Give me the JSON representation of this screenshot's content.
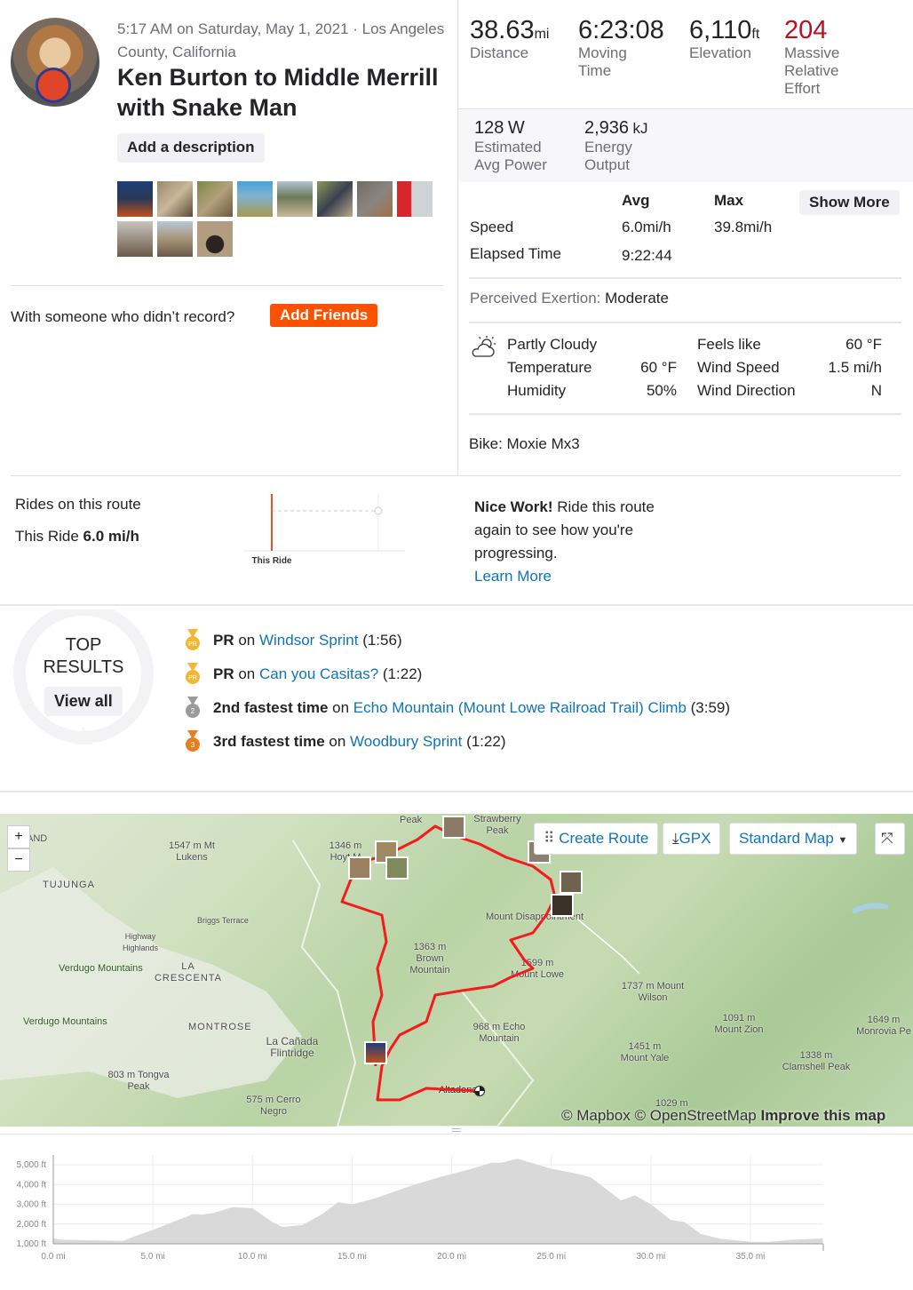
{
  "activity": {
    "meta": "5:17 AM on Saturday, May 1, 2021 · Los Angeles County, California",
    "title": "Ken Burton to Middle Merrill with Snake Man",
    "add_description": "Add a description",
    "photo_count": 11,
    "friends_prompt": "With someone who didn’t record?",
    "add_friends": "Add Friends"
  },
  "stats": {
    "distance": {
      "value": "38.63",
      "unit": "mi",
      "label": "Distance"
    },
    "moving_time": {
      "value": "6:23:08",
      "label": "Moving Time"
    },
    "elevation": {
      "value": "6,110",
      "unit": "ft",
      "label": "Elevation"
    },
    "relative_effort": {
      "value": "204",
      "label": "Massive Relative Effort",
      "color": "#b8101f"
    },
    "power": {
      "value": "128",
      "unit": "W",
      "label": "Estimated Avg Power"
    },
    "energy": {
      "value": "2,936",
      "unit": "kJ",
      "label": "Energy Output"
    },
    "table": {
      "avg_header": "Avg",
      "max_header": "Max",
      "show_more": "Show More",
      "speed_label": "Speed",
      "speed_avg": "6.0mi/h",
      "speed_max": "39.8mi/h",
      "elapsed_label": "Elapsed Time",
      "elapsed_avg": "9:22:44"
    },
    "perceived_label": "Perceived Exertion:",
    "perceived_value": "Moderate",
    "weather": {
      "icon": "partly-cloudy-icon",
      "condition": "Partly Cloudy",
      "temp_label": "Temperature",
      "temp": "60 °F",
      "humidity_label": "Humidity",
      "humidity": "50%",
      "feels_label": "Feels like",
      "feels": "60 °F",
      "wind_speed_label": "Wind Speed",
      "wind_speed": "1.5 mi/h",
      "wind_dir_label": "Wind Direction",
      "wind_dir": "N"
    },
    "bike": "Bike: Moxie Mx3"
  },
  "route": {
    "title": "Rides on this route",
    "this_ride_label": "This Ride",
    "this_ride_value": "6.0 mi/h",
    "chart_label": "This Ride",
    "nice_work": "Nice Work!",
    "nice_text": " Ride this route again to see how you're progressing.",
    "learn_more": "Learn More"
  },
  "top_results": {
    "title_1": "TOP",
    "title_2": "RESULTS",
    "view_all": "View all",
    "items": [
      {
        "medal": "PR",
        "color": "#f5b731",
        "bold": "PR",
        "on": " on ",
        "segment": "Windsor Sprint",
        "time": " (1:56)"
      },
      {
        "medal": "PR",
        "color": "#f5b731",
        "bold": "PR",
        "on": " on ",
        "segment": "Can you Casitas?",
        "time": " (1:22)"
      },
      {
        "medal": "2",
        "color": "#9b9b9b",
        "bold": "2nd fastest time",
        "on": " on ",
        "segment": "Echo Mountain (Mount Lowe Railroad Trail) Climb",
        "time": " (3:59)"
      },
      {
        "medal": "3",
        "color": "#e67e22",
        "bold": "3rd fastest time",
        "on": " on ",
        "segment": "Woodbury Sprint",
        "time": " (1:22)"
      }
    ]
  },
  "map": {
    "create_route": "Create Route",
    "gpx": "GPX",
    "map_style": "Standard Map",
    "zoom_in": "+",
    "zoom_out": "−",
    "attribution_mapbox": "© Mapbox",
    "attribution_osm": "© OpenStreetMap",
    "improve": "Improve this map",
    "route_color": "#f51b1b",
    "labels": [
      "1547 m Mt Lukens",
      "1346 m Hoyt M",
      "Peak",
      "Strawberry Peak",
      "TUJUNGA",
      "Briggs Terrace",
      "Highway Highlands",
      "LA CRESCENTA",
      "Verdugo Mountains",
      "Verdugo Mountains",
      "MONTROSE",
      "La Cañada Flintridge",
      "1363 m Brown Mountain",
      "Mount Disappointment",
      "1599 m Mount Lowe",
      "968 m Echo Mountain",
      "1737 m Mount Wilson",
      "1091 m Mount Zion",
      "1451 m Mount Yale",
      "1338 m Clamshell Peak",
      "1649 m Monrovia Pe",
      "803 m Tongva Peak",
      "575 m Cerro Negro",
      "Altadena",
      "1029 m",
      "AND"
    ]
  },
  "chart_data": {
    "type": "area",
    "xlabel": "",
    "ylabel": "",
    "x_unit": "mi",
    "y_unit": "ft",
    "xlim": [
      0,
      38.63
    ],
    "ylim": [
      1000,
      5500
    ],
    "x_ticks": [
      "0.0 mi",
      "5.0 mi",
      "10.0 mi",
      "15.0 mi",
      "20.0 mi",
      "25.0 mi",
      "30.0 mi",
      "35.0 mi"
    ],
    "y_ticks": [
      "1,000 ft",
      "2,000 ft",
      "3,000 ft",
      "4,000 ft",
      "5,000 ft"
    ],
    "grid": true,
    "fill_color": "#d9d9d9",
    "x": [
      0,
      0.5,
      2,
      3.5,
      4,
      5,
      6.5,
      7,
      7.5,
      8,
      9,
      10,
      11,
      11.5,
      12.5,
      13.5,
      14.3,
      15,
      16,
      17,
      18,
      19.5,
      21,
      22,
      22.5,
      23.3,
      25,
      26.5,
      27,
      28.5,
      29.2,
      30,
      31,
      31.7,
      32.5,
      33.5,
      35,
      36,
      37,
      38.63
    ],
    "y": [
      1270,
      1200,
      1180,
      1150,
      1350,
      1700,
      2300,
      2500,
      2480,
      2550,
      2850,
      2800,
      2100,
      1850,
      1950,
      2500,
      3100,
      3000,
      3250,
      3600,
      3950,
      4400,
      4800,
      5100,
      5100,
      5300,
      4800,
      4500,
      4350,
      3200,
      3450,
      3000,
      2200,
      2100,
      1500,
      1250,
      1100,
      1100,
      1200,
      1270
    ]
  }
}
